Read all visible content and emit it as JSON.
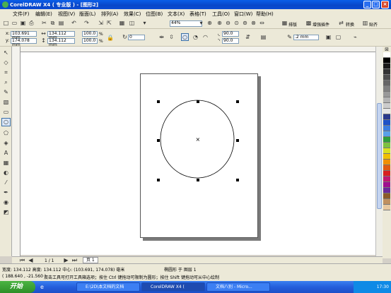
{
  "window": {
    "title": "CorelDRAW X4 ( 专业版 ) - [图形2]",
    "min": "_",
    "max": "□",
    "close": "×"
  },
  "menu": [
    "文件(F)",
    "编辑(E)",
    "视图(V)",
    "版面(L)",
    "排列(A)",
    "效果(C)",
    "位图(B)",
    "文本(X)",
    "表格(T)",
    "工具(O)",
    "窗口(W)",
    "帮助(H)"
  ],
  "toolbar": {
    "zoom": "44%",
    "snap_label": "贴齐",
    "arrange_label": "排版",
    "plugin_label": "增强插件",
    "convert_label": "转换",
    "align_label": "贴齐"
  },
  "property_bar": {
    "x": "103.691 mm",
    "y": "174.078 mm",
    "w": "134.112 mm",
    "h": "134.112 mm",
    "scale_x": "100.0",
    "scale_y": "100.0",
    "pct": "%",
    "rotation": "0",
    "start_angle": "90.0",
    "end_angle": "90.0",
    "outline": ".2 mm"
  },
  "page_nav": {
    "pages": "1 / 1",
    "page_tab": "页 1"
  },
  "status": {
    "dimensions": "宽度: 134.112 高度: 134.112 中心: (103.691, 174.078) 毫米",
    "layer": "椭圆形 于 图层 1",
    "cursor": "( 188.640 , -21.560 )",
    "hint": "双击工具可打开工具箱选项；按住 Ctrl 键拖动可限制为圆形；按住 Shift 键拖动可从中心绘制"
  },
  "taskbar": {
    "start": "开始",
    "tasks": [
      "E:\\2D\\本文档的文档",
      "CorelDRAW X4 (",
      "文档八别 - Micro..."
    ],
    "clock": "17:30"
  },
  "colors": {
    "palette": [
      "#ffffff",
      "#000000",
      "#1a1a1a",
      "#333333",
      "#4d4d4d",
      "#666666",
      "#808080",
      "#999999",
      "#b3b3b3",
      "#cccccc",
      "#e6e6e6",
      "#2a3a8c",
      "#1e52c8",
      "#3c7ee0",
      "#5aa0e8",
      "#2e9d3a",
      "#7dc040",
      "#d8e020",
      "#f0c000",
      "#f09000",
      "#e05a10",
      "#d82020",
      "#c01870",
      "#a01090",
      "#6a2a9a",
      "#8a5a2a",
      "#c09060",
      "#e8c8a0"
    ]
  }
}
